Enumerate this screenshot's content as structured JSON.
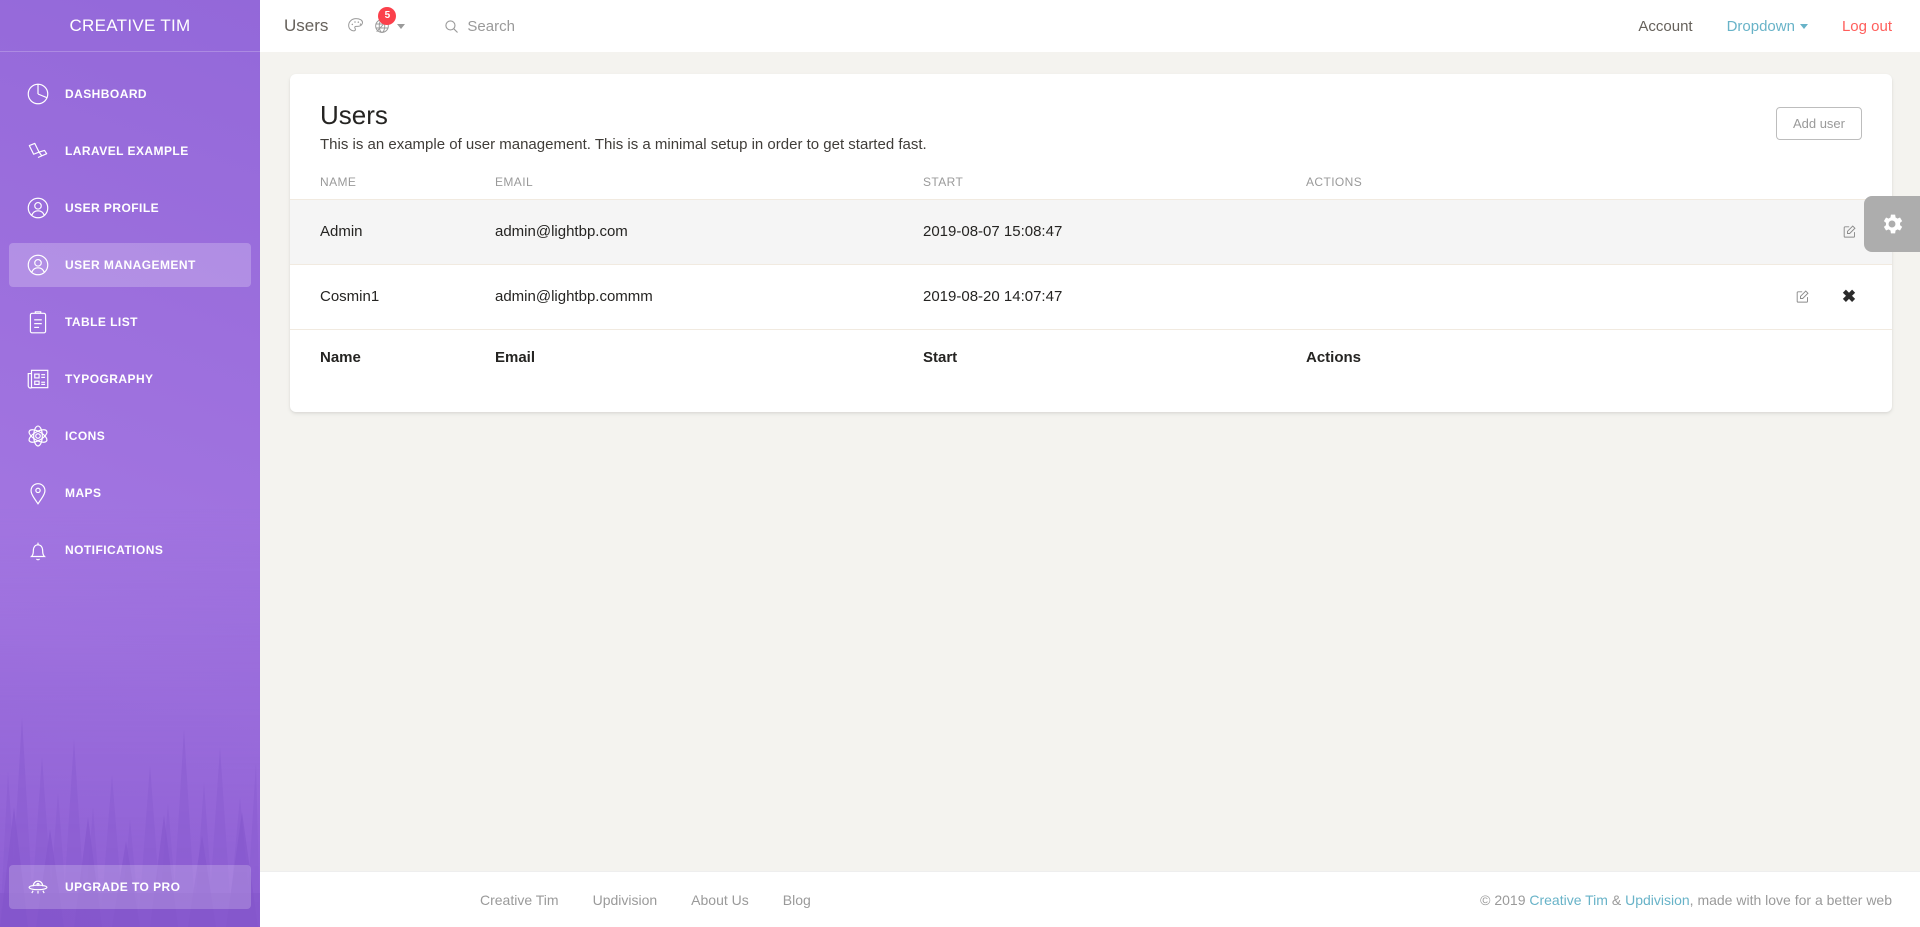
{
  "sidebar": {
    "brand": "CREATIVE TIM",
    "items": [
      {
        "label": "DASHBOARD",
        "icon": "pie-chart-icon",
        "active": false
      },
      {
        "label": "LARAVEL EXAMPLE",
        "icon": "laravel-icon",
        "active": false
      },
      {
        "label": "USER PROFILE",
        "icon": "user-circle-icon",
        "active": false
      },
      {
        "label": "USER MANAGEMENT",
        "icon": "user-circle-icon",
        "active": true
      },
      {
        "label": "TABLE LIST",
        "icon": "clipboard-icon",
        "active": false
      },
      {
        "label": "TYPOGRAPHY",
        "icon": "newspaper-icon",
        "active": false
      },
      {
        "label": "ICONS",
        "icon": "atom-icon",
        "active": false
      },
      {
        "label": "MAPS",
        "icon": "map-pin-icon",
        "active": false
      },
      {
        "label": "NOTIFICATIONS",
        "icon": "bell-icon",
        "active": false
      }
    ],
    "upgrade": {
      "label": "UPGRADE TO PRO",
      "icon": "ufo-icon"
    }
  },
  "navbar": {
    "title": "Users",
    "palette_icon": "palette-icon",
    "notification_icon": "globe-icon",
    "notification_badge": "5",
    "search_label": "Search",
    "search_icon": "search-icon",
    "account_label": "Account",
    "dropdown_label": "Dropdown",
    "logout_label": "Log out"
  },
  "card": {
    "title": "Users",
    "subtitle": "This is an example of user management. This is a minimal setup in order to get started fast.",
    "add_button": "Add user",
    "headers": [
      "NAME",
      "EMAIL",
      "START",
      "ACTIONS"
    ],
    "rows": [
      {
        "name": "Admin",
        "email": "admin@lightbp.com",
        "start": "2019-08-07 15:08:47",
        "actions": [
          "edit"
        ]
      },
      {
        "name": "Cosmin1",
        "email": "admin@lightbp.commm",
        "start": "2019-08-20 14:07:47",
        "actions": [
          "edit",
          "delete"
        ]
      }
    ],
    "footer_row": [
      "Name",
      "Email",
      "Start",
      "Actions"
    ]
  },
  "settings_tab": {
    "icon": "gear-icon"
  },
  "footer": {
    "links": [
      "Creative Tim",
      "Updivision",
      "About Us",
      "Blog"
    ],
    "copy_prefix": "© 2019 ",
    "copy_link1": "Creative Tim",
    "copy_amp": " & ",
    "copy_link2": "Updivision",
    "copy_suffix": ", made with love for a better web"
  },
  "colors": {
    "sidebar_purple": "#9c6fdd",
    "accent_cyan": "#68B3C8",
    "danger_red": "#FF5E5B",
    "badge_red": "#fb404b"
  }
}
